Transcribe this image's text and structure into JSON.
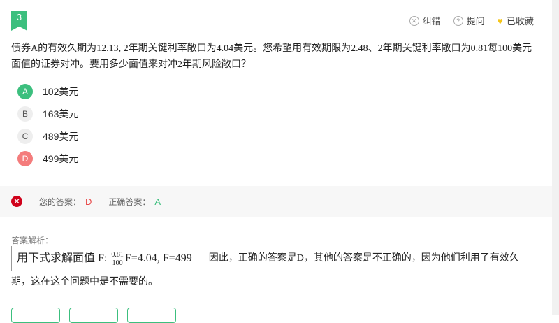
{
  "question": {
    "number": "3",
    "text": "债券A的有效久期为12.13, 2年期关键利率敞口为4.04美元。您希望用有效期限为2.48、2年期关键利率敞口为0.81每100美元面值的证券对冲。要用多少面值来对冲2年期风险敞口？"
  },
  "actions": {
    "report": "纠错",
    "ask": "提问",
    "favorite": "已收藏"
  },
  "options": [
    {
      "letter": "A",
      "text": "102美元",
      "state": "correct"
    },
    {
      "letter": "B",
      "text": "163美元",
      "state": "normal"
    },
    {
      "letter": "C",
      "text": "489美元",
      "state": "normal"
    },
    {
      "letter": "D",
      "text": "499美元",
      "state": "wrong"
    }
  ],
  "result": {
    "your_label": "您的答案：",
    "your_answer": "D",
    "correct_label": "正确答案：",
    "correct_answer": "A"
  },
  "analysis": {
    "title": "答案解析：",
    "formula_prefix": "用下式求解面值 F: ",
    "formula_num": "0.81",
    "formula_den": "100",
    "formula_suffix": "F=4.04, F=499",
    "text": "因此，正确的答案是D，其他的答案是不正确的，因为他们利用了有效久期，这在这个问题中是不需要的。"
  },
  "colors": {
    "accent": "#3cbf7e",
    "wrong": "#f47c7c",
    "error_icon": "#d0021b",
    "favorite": "#f5c518"
  }
}
